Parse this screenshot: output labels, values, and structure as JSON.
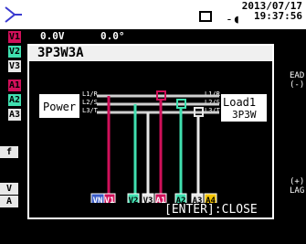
{
  "status": {
    "date": "2013/07/17",
    "time": "19:37:56",
    "icons": [
      "waveform-icon",
      "battery-icon",
      "ac-plug-icon"
    ]
  },
  "background": {
    "readings_partial": [
      "0.0V",
      "0.0°"
    ],
    "side_labels": [
      "V1",
      "V2",
      "V3",
      "A1",
      "A2",
      "A3",
      "f",
      "V",
      "A"
    ],
    "right_fragments": [
      "EAD",
      "(-)",
      "(+)",
      "LAG"
    ]
  },
  "dialog": {
    "title": "3P3W3A",
    "source_label": "Power",
    "load_label": "Load1",
    "load_sub": "3P3W",
    "lines_left": [
      "L1/R",
      "L2/S",
      "L3/T"
    ],
    "lines_right": [
      "L1/R",
      "L2/S",
      "L3/T"
    ],
    "terminals": [
      "VN",
      "V1",
      "V2",
      "V3",
      "A1",
      "A2",
      "A3",
      "A4"
    ],
    "close_hint": "[ENTER]:CLOSE"
  },
  "colors": {
    "v1": "#d0105a",
    "v2": "#40e0b0",
    "v3": "#e8e8e8",
    "a1": "#d0105a",
    "a2": "#40e0b0",
    "a3": "#e8e8e8",
    "a4": "#f5c400",
    "vn": "#3a5cc8"
  }
}
